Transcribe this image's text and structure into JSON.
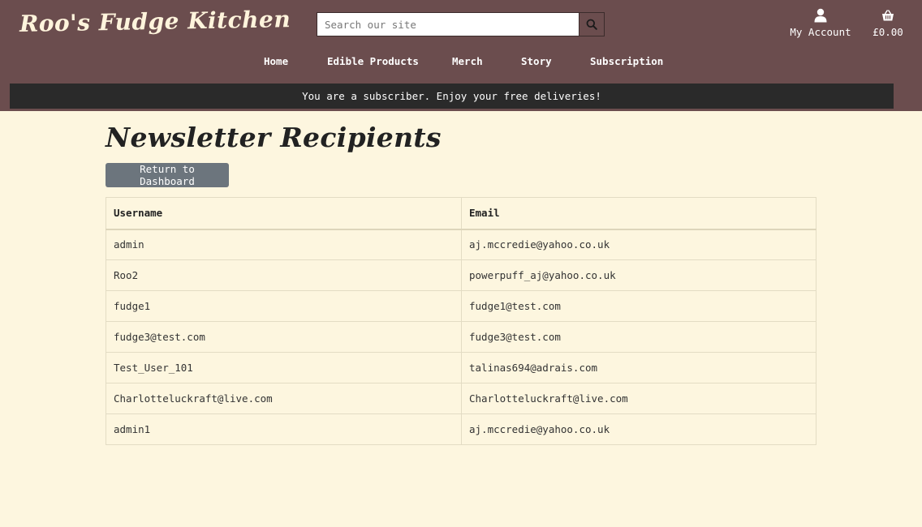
{
  "site": {
    "logo_text": "Roo's Fudge Kitchen"
  },
  "search": {
    "placeholder": "Search our site",
    "icon": "search-icon"
  },
  "account": {
    "label": "My Account",
    "icon": "user-icon"
  },
  "cart": {
    "total": "£0.00",
    "icon": "basket-icon"
  },
  "nav": {
    "items": [
      {
        "label": "Home"
      },
      {
        "label": "Edible Products"
      },
      {
        "label": "Merch"
      },
      {
        "label": "Story"
      },
      {
        "label": "Subscription"
      }
    ]
  },
  "banner": {
    "message": "You are a subscriber. Enjoy your free deliveries!"
  },
  "page": {
    "title": "Newsletter Recipients",
    "return_button": "Return to Dashboard"
  },
  "table": {
    "headers": [
      "Username",
      "Email"
    ],
    "rows": [
      {
        "username": "admin",
        "email": "aj.mccredie@yahoo.co.uk"
      },
      {
        "username": "Roo2",
        "email": "powerpuff_aj@yahoo.co.uk"
      },
      {
        "username": "fudge1",
        "email": "fudge1@test.com"
      },
      {
        "username": "fudge3@test.com",
        "email": "fudge3@test.com"
      },
      {
        "username": "Test_User_101",
        "email": "talinas694@adrais.com"
      },
      {
        "username": "Charlotteluckraft@live.com",
        "email": "Charlotteluckraft@live.com"
      },
      {
        "username": "admin1",
        "email": "aj.mccredie@yahoo.co.uk"
      }
    ]
  },
  "colors": {
    "header_bg": "#6b4d4e",
    "page_bg": "#fdf6df",
    "banner_bg": "#2a2a2a",
    "button_bg": "#6c757d"
  }
}
